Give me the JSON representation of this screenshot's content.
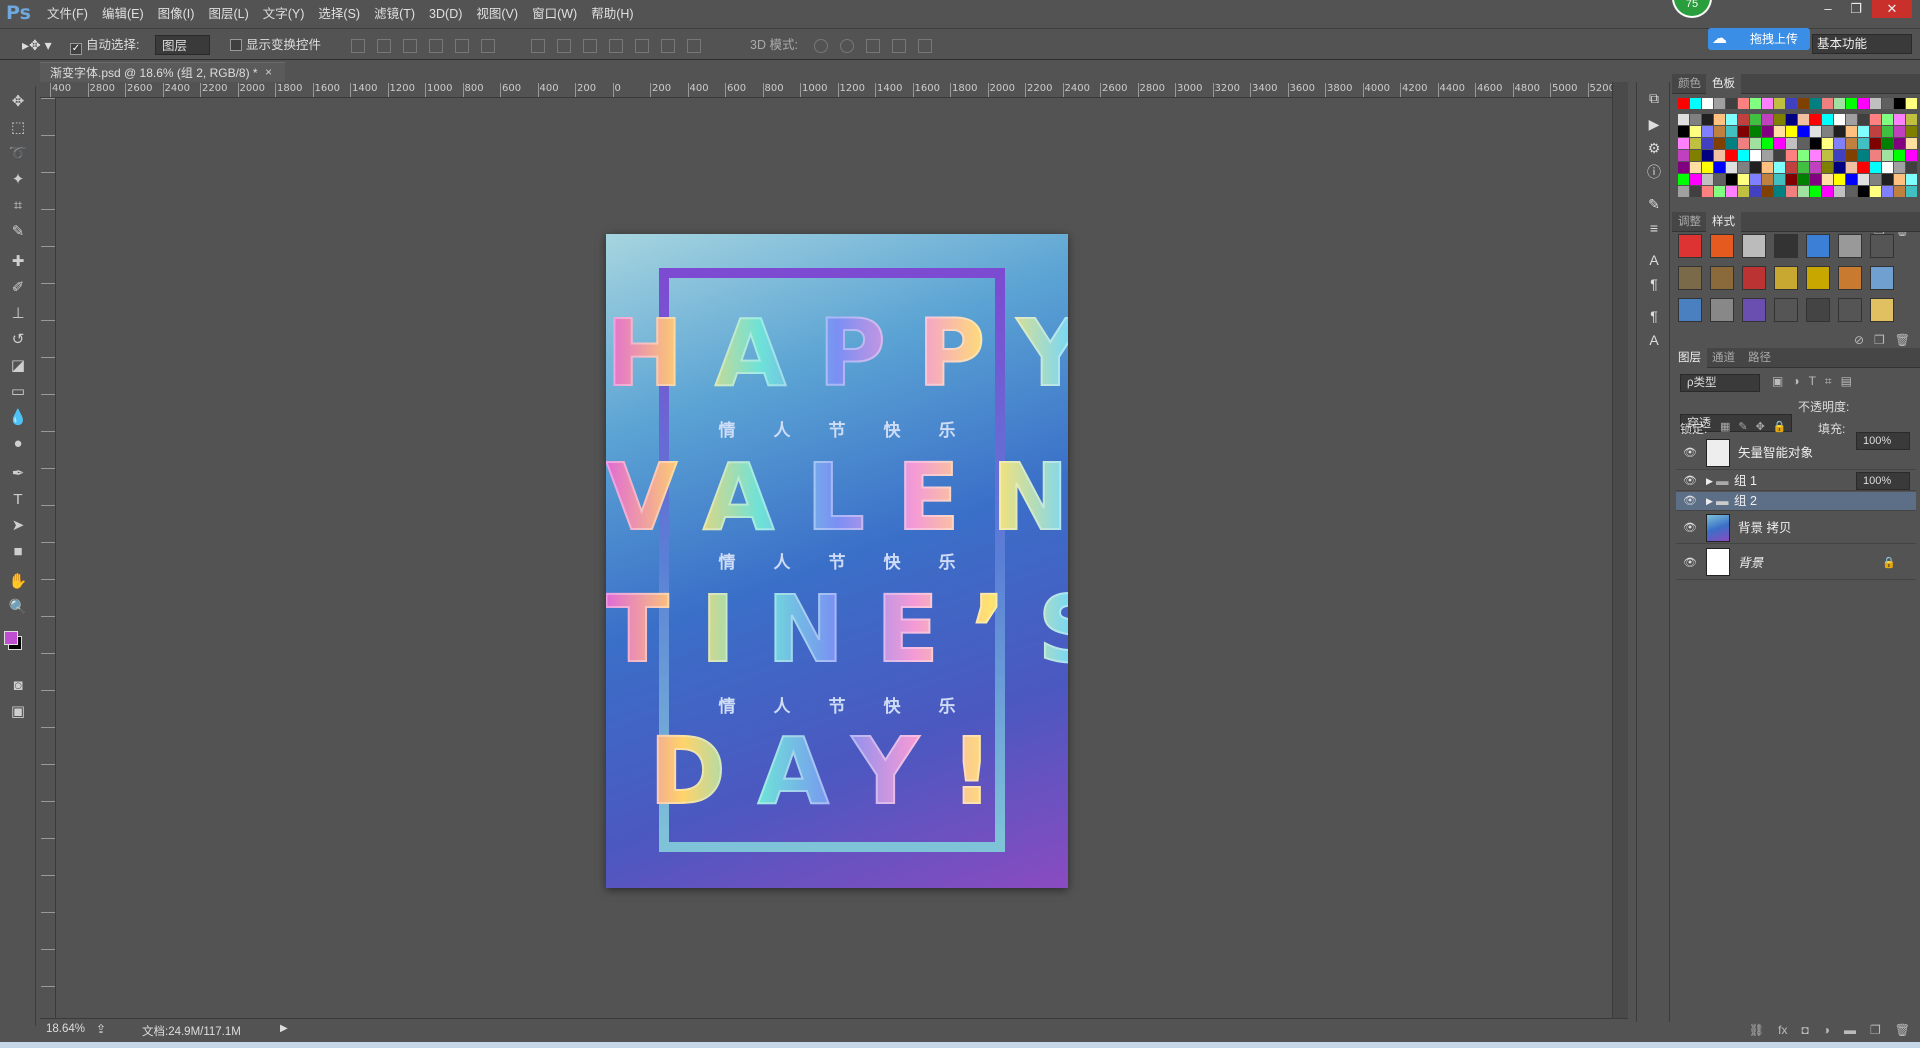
{
  "app": {
    "logo": "Ps",
    "badge": "75"
  },
  "menu": [
    "文件(F)",
    "编辑(E)",
    "图像(I)",
    "图层(L)",
    "文字(Y)",
    "选择(S)",
    "滤镜(T)",
    "3D(D)",
    "视图(V)",
    "窗口(W)",
    "帮助(H)"
  ],
  "window_controls": {
    "minimize": "–",
    "restore": "❐",
    "close": "✕"
  },
  "options": {
    "auto_select_label": "自动选择:",
    "auto_select_checked": "✓",
    "auto_select_value": "图层",
    "show_transform_label": "显示变换控件",
    "mode_3d_label": "3D 模式:",
    "upload_label": "拖拽上传",
    "workspace": "基本功能"
  },
  "document": {
    "tab_title": "渐变字体.psd @ 18.6% (组 2, RGB/8) *",
    "close": "×"
  },
  "ruler": {
    "h_labels": [
      "400",
      "2800",
      "2600",
      "2400",
      "2200",
      "2000",
      "1800",
      "1600",
      "1400",
      "1200",
      "1000",
      "800",
      "600",
      "400",
      "200",
      "0",
      "200",
      "400",
      "600",
      "800",
      "1000",
      "1200",
      "1400",
      "1600",
      "1800",
      "2000",
      "2200",
      "2400",
      "2600",
      "2800",
      "3000",
      "3200",
      "3400",
      "3600",
      "3800",
      "4000",
      "4200",
      "4400",
      "4600",
      "4800",
      "5000",
      "5200"
    ]
  },
  "poster": {
    "line1": "HAPPY",
    "line2": "VALEN",
    "line3": "TINE’S",
    "line4": "DAY!",
    "sub1": "情人节快乐",
    "sub2": "情人节快乐",
    "sub3": "情人节快乐"
  },
  "status": {
    "zoom": "18.64%",
    "doc_size": "文档:24.9M/117.1M"
  },
  "panels": {
    "color_tabs": [
      "颜色",
      "色板"
    ],
    "adjust_tabs": [
      "调整",
      "样式"
    ],
    "layer_tabs": [
      "图层",
      "通道",
      "路径"
    ],
    "filter_kind": "ρ类型",
    "blend_mode": "穿透",
    "opacity_label": "不透明度:",
    "opacity_value": "100%",
    "lock_label": "锁定:",
    "fill_label": "填充:",
    "fill_value": "100%"
  },
  "layers": [
    {
      "name": "矢量智能对象",
      "type": "smart"
    },
    {
      "name": "组 1",
      "type": "group"
    },
    {
      "name": "组 2",
      "type": "group",
      "selected": true
    },
    {
      "name": "背景 拷贝",
      "type": "gradient"
    },
    {
      "name": "背景",
      "type": "background",
      "locked": true
    }
  ],
  "colors": {
    "foreground": "#c04fd0",
    "background": "#000000",
    "accent": "#3a8ee6"
  }
}
